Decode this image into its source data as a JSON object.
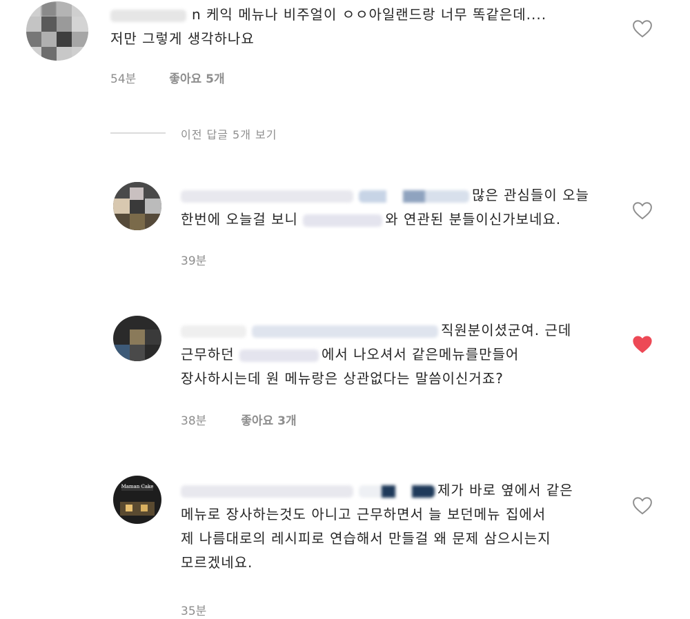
{
  "comments": [
    {
      "text_lines": [
        "n 케익 메뉴나 비주얼이 ㅇㅇ아일랜드랑 너무 똑같은데....",
        "저만 그렇게 생각하나요"
      ],
      "time": "54분",
      "likes": "좋아요 5개",
      "liked": false
    }
  ],
  "view_previous_replies": "이전 답글 5개 보기",
  "replies": [
    {
      "text_lines": [
        "많은 관심들이 오늘",
        "한번에 오늘걸 보니",
        "와 연관된 분들이신가보네요."
      ],
      "time": "39분",
      "liked": false
    },
    {
      "text_lines": [
        "직원분이셨군여. 근데",
        "근무하던",
        "에서 나오셔서 같은메뉴를만들어",
        "장사하시는데 원 메뉴랑은 상관없다는 말씀이신거죠?"
      ],
      "time": "38분",
      "likes": "좋아요 3개",
      "liked": true
    },
    {
      "text_lines": [
        "제가 바로 옆에서 같은",
        "메뉴로 장사하는것도 아니고 근무하면서 늘 보던메뉴 집에서",
        "제 나름대로의 레시피로 연습해서 만들걸 왜 문제 삼으시는지",
        "모르겠네요."
      ],
      "time": "35분",
      "liked": false,
      "avatar_label": "Maman Cake"
    }
  ],
  "colors": {
    "text": "#262626",
    "meta": "#8e8e8e",
    "heart_outline": "#8e8e8e",
    "heart_liked": "#ed4956",
    "divider": "#dbdbdb"
  }
}
